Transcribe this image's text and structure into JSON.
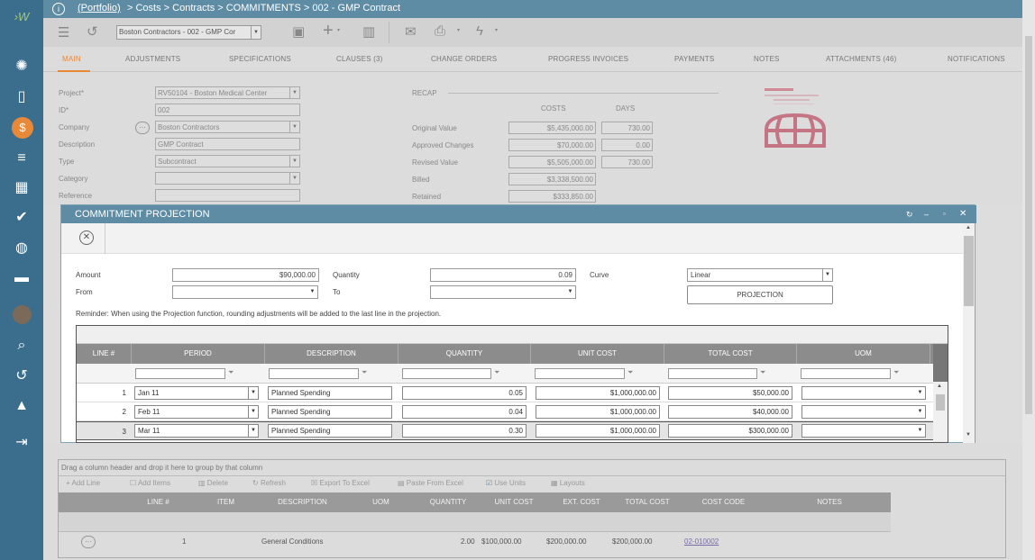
{
  "app": {
    "breadcrumb_portfolio": "(Portfolio)",
    "breadcrumb_rest": " > Costs > Contracts > COMMITMENTS > 002 - GMP Contract",
    "record_selector": "Boston Contractors - 002 - GMP Cor"
  },
  "tabs": [
    "MAIN",
    "ADJUSTMENTS",
    "SPECIFICATIONS",
    "CLAUSES (3)",
    "CHANGE ORDERS",
    "PROGRESS INVOICES",
    "PAYMENTS",
    "NOTES",
    "ATTACHMENTS (46)",
    "NOTIFICATIONS"
  ],
  "form": {
    "project_label": "Project*",
    "project_value": "RV50104 - Boston Medical Center",
    "id_label": "ID*",
    "id_value": "002",
    "company_label": "Company",
    "company_value": "Boston Contractors",
    "description_label": "Description",
    "description_value": "GMP Contract",
    "type_label": "Type",
    "type_value": "Subcontract",
    "category_label": "Category",
    "category_value": "",
    "reference_label": "Reference",
    "reference_value": ""
  },
  "recap": {
    "title": "RECAP",
    "costs_header": "COSTS",
    "days_header": "DAYS",
    "rows": [
      {
        "label": "Original Value",
        "cost": "$5,435,000.00",
        "days": "730.00"
      },
      {
        "label": "Approved Changes",
        "cost": "$70,000.00",
        "days": "0.00"
      },
      {
        "label": "Revised Value",
        "cost": "$5,505,000.00",
        "days": "730.00"
      },
      {
        "label": "Billed",
        "cost": "$3,338,500.00",
        "days": ""
      },
      {
        "label": "Retained",
        "cost": "$333,850.00",
        "days": ""
      }
    ]
  },
  "modal": {
    "title": "COMMITMENT PROJECTION",
    "amount_label": "Amount",
    "amount_value": "$90,000.00",
    "quantity_label": "Quantity",
    "quantity_value": "0.09",
    "curve_label": "Curve",
    "curve_value": "Linear",
    "from_label": "From",
    "from_value": "",
    "to_label": "To",
    "to_value": "",
    "projection_button": "PROJECTION",
    "reminder": "Reminder: When using the Projection function, rounding adjustments will be added to the last line in the projection.",
    "columns": [
      "LINE #",
      "PERIOD",
      "DESCRIPTION",
      "QUANTITY",
      "UNIT COST",
      "TOTAL COST",
      "UOM"
    ],
    "rows": [
      {
        "line": "1",
        "period": "Jan 11",
        "description": "Planned Spending",
        "quantity": "0.05",
        "unit_cost": "$1,000,000.00",
        "total_cost": "$50,000.00",
        "uom": ""
      },
      {
        "line": "2",
        "period": "Feb 11",
        "description": "Planned Spending",
        "quantity": "0.04",
        "unit_cost": "$1,000,000.00",
        "total_cost": "$40,000.00",
        "uom": ""
      },
      {
        "line": "3",
        "period": "Mar 11",
        "description": "Planned Spending",
        "quantity": "0.30",
        "unit_cost": "$1,000,000.00",
        "total_cost": "$300,000.00",
        "uom": ""
      }
    ]
  },
  "bottom": {
    "group_hint": "Drag a column header and drop it here to group by that column",
    "toolbar": [
      "Add Line",
      "Add Items",
      "Delete",
      "Refresh",
      "Export To Excel",
      "Paste From Excel",
      "Use Units",
      "Layouts"
    ],
    "columns": [
      "LINE #",
      "ITEM",
      "DESCRIPTION",
      "UOM",
      "QUANTITY",
      "UNIT COST",
      "EXT. COST",
      "TOTAL COST",
      "COST CODE",
      "NOTES"
    ],
    "row": {
      "line": "1",
      "item": "",
      "description": "General Conditions",
      "uom": "",
      "quantity": "2.00",
      "unit_cost": "$100,000.00",
      "ext_cost": "$200,000.00",
      "total_cost": "$200,000.00",
      "cost_code": "02-010002",
      "notes": ""
    }
  },
  "colors": {
    "sidebar": "#3a6e8c",
    "header": "#5f8ca5",
    "grid_header": "#8c8c8c",
    "accent": "#e8893a"
  }
}
